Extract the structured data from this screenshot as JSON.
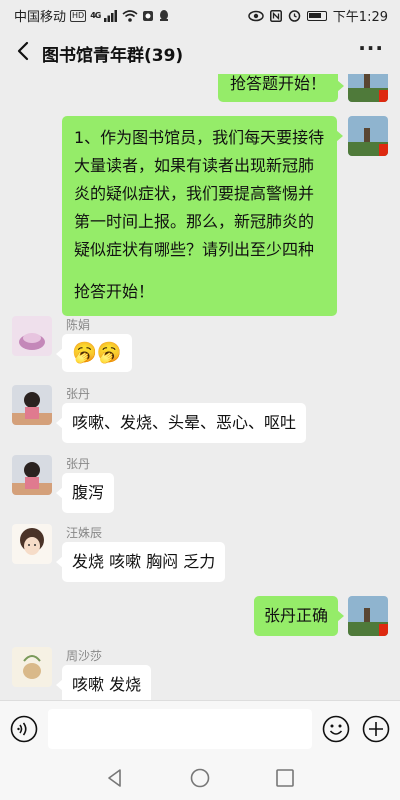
{
  "status_bar": {
    "carrier": "中国移动",
    "hd": "HD",
    "network": "4G",
    "time": "下午1:29"
  },
  "header": {
    "title": "图书馆青年群(39)",
    "more_icon": "more-dots-icon",
    "back_icon": "back-arrow-icon"
  },
  "messages": [
    {
      "sender": "me",
      "text": "抢答题开始！"
    },
    {
      "sender": "me",
      "lines": [
        "1、作为图书馆员，我们每天要接待",
        "大量读者，如果有读者出现新冠肺",
        "炎的疑似症状，我们要提高警惕并",
        "第一时间上报。那么，新冠肺炎的",
        "疑似症状有哪些？请列出至少四种",
        "",
        "抢答开始！"
      ]
    },
    {
      "sender": "陈娟",
      "text": "🥱🥱"
    },
    {
      "sender": "张丹",
      "text": "咳嗽、发烧、头晕、恶心、呕吐"
    },
    {
      "sender": "张丹",
      "text": "腹泻"
    },
    {
      "sender": "汪姝辰",
      "text": "发烧 咳嗽 胸闷 乏力"
    },
    {
      "sender": "me",
      "text": "张丹正确"
    },
    {
      "sender": "周沙莎",
      "text": "咳嗽 发烧"
    }
  ],
  "input_bar": {
    "voice_icon": "voice-icon",
    "emoji_icon": "emoji-icon",
    "plus_icon": "plus-icon",
    "placeholder": ""
  },
  "colors": {
    "my_bubble": "#95ec69",
    "other_bubble": "#ffffff",
    "background": "#ededed"
  }
}
